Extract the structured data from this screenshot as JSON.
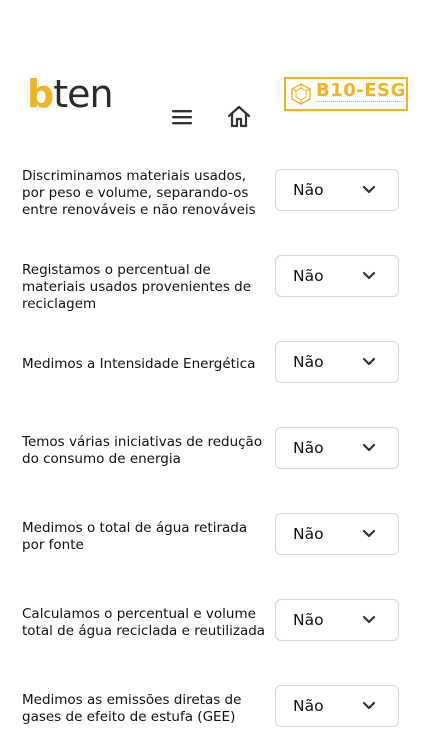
{
  "header": {
    "logo_bten_b": "b",
    "logo_bten_rest": "ten",
    "logo_esg": "B10-ESG",
    "icons": [
      "menu-icon",
      "home-icon"
    ]
  },
  "colors": {
    "brand_yellow": "#f2b320",
    "text": "#111111",
    "select_border": "#d6d6d6"
  },
  "questions": [
    {
      "label": "Discriminamos materiais usados, por peso e volume, separando-os entre renováveis e não renováveis",
      "value": "Não"
    },
    {
      "label": "Registamos o percentual de materiais usados provenientes de reciclagem",
      "value": "Não"
    },
    {
      "label": "Medimos a Intensidade Energética",
      "value": "Não"
    },
    {
      "label": "Temos várias iniciativas de redução do consumo de energia",
      "value": "Não"
    },
    {
      "label": "Medimos o total de água retirada por fonte",
      "value": "Não"
    },
    {
      "label": "Calculamos o percentual e volume total de água reciclada e reutilizada",
      "value": "Não"
    },
    {
      "label": "Medimos as emissões diretas de gases de efeito de estufa (GEE)",
      "value": "Não"
    }
  ]
}
